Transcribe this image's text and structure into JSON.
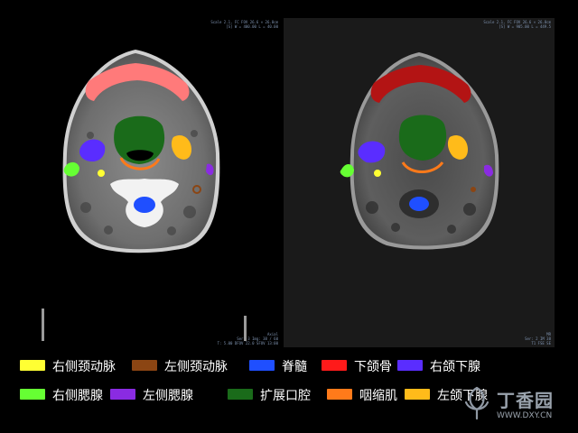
{
  "scan_left": {
    "header_lines": [
      "Scale 2.1, FC FOV 26.6 × 26.8cm",
      "[S] W = 400.00 L = 40.00"
    ],
    "footer_lines": [
      "Axial",
      "Ser: 3 Img: 38 / 60",
      "T: 5.00 DFOV 22.0 SFOV 13:00"
    ]
  },
  "scan_right": {
    "header_lines": [
      "Scale 2.1, FC FOV 26.6 × 26.8cm",
      "[S] W = 905.00 L = 449.5"
    ],
    "footer_lines": [
      "MR",
      "Ser: 2 IM 38",
      "T1 FSE SE"
    ]
  },
  "legend": {
    "items": [
      {
        "label": "右侧颈动脉",
        "color": "#ffff33"
      },
      {
        "label": "左侧颈动脉",
        "color": "#8b4513"
      },
      {
        "label": "脊髓",
        "color": "#1f4fff"
      },
      {
        "label": "下颌骨",
        "color": "#ff1a1a"
      },
      {
        "label": "右颌下腺",
        "color": "#5a2dff"
      },
      {
        "label": "右侧腮腺",
        "color": "#66ff33"
      },
      {
        "label": "左侧腮腺",
        "color": "#8a2be2"
      },
      {
        "label": "扩展口腔",
        "color": "#1a6b1a"
      },
      {
        "label": "咽缩肌",
        "color": "#ff7a1a"
      },
      {
        "label": "左颌下腺",
        "color": "#ffbb1a"
      }
    ]
  },
  "watermark": {
    "brand": "丁香园",
    "url": "WWW.DXY.CN"
  }
}
